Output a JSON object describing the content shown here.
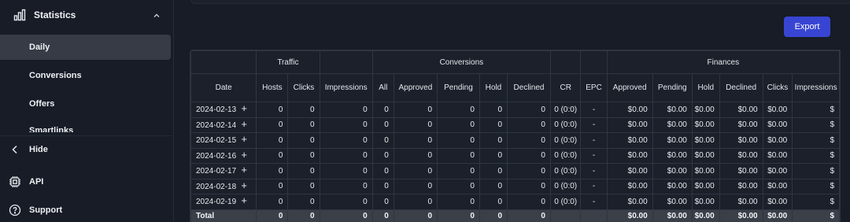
{
  "sidebar": {
    "section_title": "Statistics",
    "items": [
      {
        "label": "Daily",
        "active": true
      },
      {
        "label": "Conversions",
        "active": false
      },
      {
        "label": "Offers",
        "active": false
      },
      {
        "label": "Smartlinks",
        "active": false
      }
    ],
    "bottom": {
      "hide_label": "Hide",
      "api_label": "API",
      "support_label": "Support"
    }
  },
  "toolbar": {
    "export_label": "Export"
  },
  "table": {
    "groups": {
      "traffic": "Traffic",
      "conversions": "Conversions",
      "finances": "Finances"
    },
    "columns": [
      "Date",
      "Hosts",
      "Clicks",
      "Impressions",
      "All",
      "Approved",
      "Pending",
      "Hold",
      "Declined",
      "CR",
      "EPC",
      "Approved",
      "Pending",
      "Hold",
      "Declined",
      "Clicks",
      "Impressions"
    ],
    "rows": [
      [
        "2024-02-13",
        "0",
        "0",
        "0",
        "0",
        "0",
        "0",
        "0",
        "0",
        "0 (0:0)",
        "-",
        "$0.00",
        "$0.00",
        "$0.00",
        "$0.00",
        "$0.00",
        "$"
      ],
      [
        "2024-02-14",
        "0",
        "0",
        "0",
        "0",
        "0",
        "0",
        "0",
        "0",
        "0 (0:0)",
        "-",
        "$0.00",
        "$0.00",
        "$0.00",
        "$0.00",
        "$0.00",
        "$"
      ],
      [
        "2024-02-15",
        "0",
        "0",
        "0",
        "0",
        "0",
        "0",
        "0",
        "0",
        "0 (0:0)",
        "-",
        "$0.00",
        "$0.00",
        "$0.00",
        "$0.00",
        "$0.00",
        "$"
      ],
      [
        "2024-02-16",
        "0",
        "0",
        "0",
        "0",
        "0",
        "0",
        "0",
        "0",
        "0 (0:0)",
        "-",
        "$0.00",
        "$0.00",
        "$0.00",
        "$0.00",
        "$0.00",
        "$"
      ],
      [
        "2024-02-17",
        "0",
        "0",
        "0",
        "0",
        "0",
        "0",
        "0",
        "0",
        "0 (0:0)",
        "-",
        "$0.00",
        "$0.00",
        "$0.00",
        "$0.00",
        "$0.00",
        "$"
      ],
      [
        "2024-02-18",
        "0",
        "0",
        "0",
        "0",
        "0",
        "0",
        "0",
        "0",
        "0 (0:0)",
        "-",
        "$0.00",
        "$0.00",
        "$0.00",
        "$0.00",
        "$0.00",
        "$"
      ],
      [
        "2024-02-19",
        "0",
        "0",
        "0",
        "0",
        "0",
        "0",
        "0",
        "0",
        "0 (0:0)",
        "-",
        "$0.00",
        "$0.00",
        "$0.00",
        "$0.00",
        "$0.00",
        "$"
      ]
    ],
    "total": [
      "Total",
      "0",
      "0",
      "0",
      "0",
      "0",
      "0",
      "0",
      "0",
      "",
      "",
      "$0.00",
      "$0.00",
      "$0.00",
      "$0.00",
      "$0.00",
      "$"
    ]
  },
  "colors": {
    "background": "#171c26",
    "accent": "#3845d3",
    "active_item": "#363b45",
    "total_row": "#3a3f48"
  },
  "icons": {
    "section": "bar-chart-icon",
    "collapse": "chevron-up-icon",
    "hide": "chevron-left-icon",
    "api": "chip-icon",
    "support": "help-circle-icon",
    "expand_row": "plus-icon"
  }
}
